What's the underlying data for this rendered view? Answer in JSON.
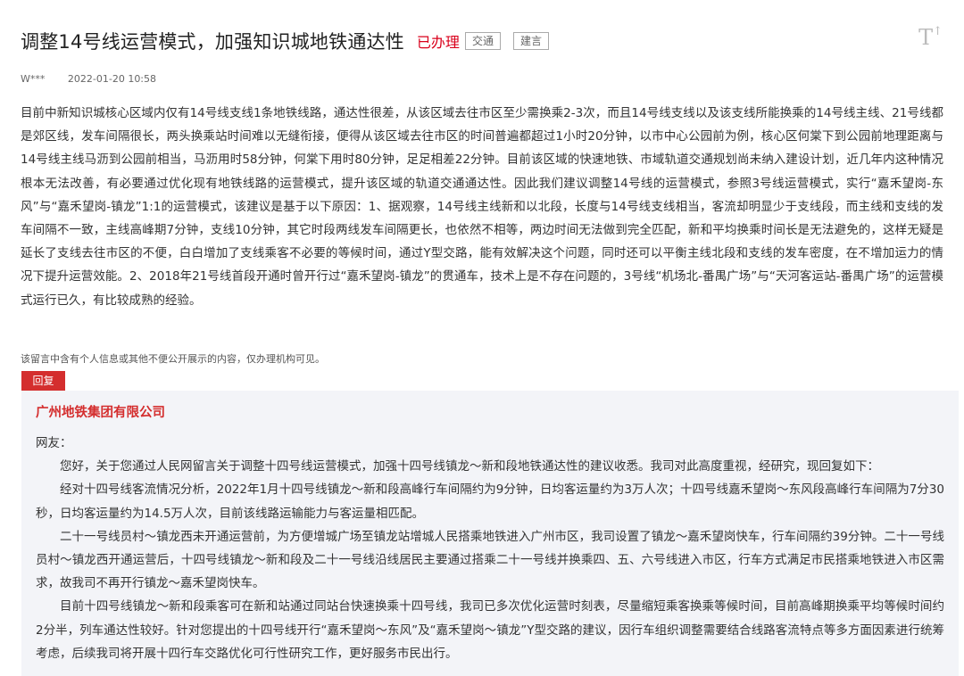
{
  "post": {
    "title": "调整14号线运营模式，加强知识城地铁通达性",
    "status": "已办理",
    "tags": [
      "交通",
      "建言"
    ],
    "font_toggle": "T",
    "author": "W***",
    "time": "2022-01-20 10:58",
    "content": "目前中新知识城核心区域内仅有14号线支线1条地铁线路，通达性很差，从该区域去往市区至少需换乘2-3次，而且14号线支线以及该支线所能换乘的14号线主线、21号线都是郊区线，发车间隔很长，两头换乘站时间难以无缝衔接，便得从该区域去往市区的时间普遍都超过1小时20分钟，以市中心公园前为例，核心区何棠下到公园前地理距离与14号线主线马沥到公园前相当，马沥用时58分钟，何棠下用时80分钟，足足相差22分钟。目前该区域的快速地铁、市域轨道交通规划尚未纳入建设计划，近几年内这种情况根本无法改善，有必要通过优化现有地铁线路的运营模式，提升该区域的轨道交通通达性。因此我们建议调整14号线的运营模式，参照3号线运营模式，实行“嘉禾望岗-东风”与“嘉禾望岗-镇龙”1:1的运营模式，该建议是基于以下原因：1、据观察，14号线主线新和以北段，长度与14号线支线相当，客流却明显少于支线段，而主线和支线的发车间隔不一致，主线高峰期7分钟，支线10分钟，其它时段两线发车间隔更长，也依然不相等，两边时间无法做到完全匹配，新和平均换乘时间长是无法避免的，这样无疑是延长了支线去往市区的不便，白白增加了支线乘客不必要的等候时间，通过Y型交路，能有效解决这个问题，同时还可以平衡主线北段和支线的发车密度，在不增加运力的情况下提升运营效能。2、2018年21号线首段开通时曾开行过“嘉禾望岗-镇龙”的贯通车，技术上是不存在问题的，3号线“机场北-番禺广场”与“天河客运站-番禺广场”的运营模式运行已久，有比较成熟的经验。",
    "privacy_note": "该留言中含有个人信息或其他不便公开展示的内容，仅办理机构可见。"
  },
  "reply": {
    "label": "回复",
    "org": "广州地铁集团有限公司",
    "greeting": "网友：",
    "paragraphs": [
      "您好，关于您通过人民网留言关于调整十四号线运营模式，加强十四号线镇龙～新和段地铁通达性的建议收悉。我司对此高度重视，经研究，现回复如下：",
      "经对十四号线客流情况分析，2022年1月十四号线镇龙～新和段高峰行车间隔约为9分钟，日均客运量约为3万人次；十四号线嘉禾望岗～东风段高峰行车间隔为7分30秒，日均客运量约为14.5万人次，目前该线路运输能力与客运量相匹配。",
      "二十一号线员村～镇龙西未开通运营前，为方便增城广场至镇龙站增城人民搭乘地铁进入广州市区，我司设置了镇龙～嘉禾望岗快车，行车间隔约39分钟。二十一号线员村～镇龙西开通运营后，十四号线镇龙～新和段及二十一号线沿线居民主要通过搭乘二十一号线并换乘四、五、六号线进入市区，行车方式满足市民搭乘地铁进入市区需求，故我司不再开行镇龙～嘉禾望岗快车。",
      "目前十四号线镇龙～新和段乘客可在新和站通过同站台快速换乘十四号线，我司已多次优化运营时刻表，尽量缩短乘客换乘等候时间，目前高峰期换乘平均等候时间约2分半，列车通达性较好。针对您提出的十四号线开行“嘉禾望岗～东风”及“嘉禾望岗～镇龙”Y型交路的建议，因行车组织调整需要结合线路客流特点等多方面因素进行统筹考虑，后续我司将开展十四行车交路优化可行性研究工作，更好服务市民出行。"
    ]
  }
}
